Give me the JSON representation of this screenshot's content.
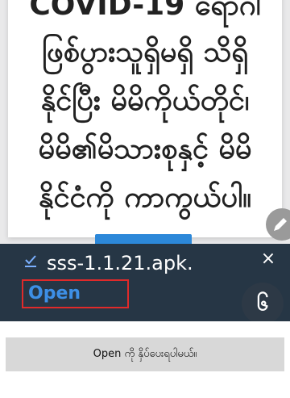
{
  "article": {
    "lines": [
      "COVID-19 ရောဂါ",
      "ဖြစ်ပွားသူရှိမရှိ သိရှိ",
      "နိုင်ပြီး မိမိကိုယ်တိုင်၊",
      "မိမိ၏မိသားစုနှင့် မိမိ",
      "နိုင်ငံကို ကာကွယ်ပါ။"
    ]
  },
  "download": {
    "icon": "download-done-icon",
    "filename": "sss-1.1.21.apk.",
    "close_label": "×",
    "open_label": "Open"
  },
  "edit_icon": "pencil-icon",
  "step_badge": "၆",
  "caption": "Open ကို နှိပ်ပေးရပါမယ်။",
  "colors": {
    "download_bar": "#263645",
    "open_text": "#3d8fe6",
    "highlight_box": "#e02a2a",
    "sheet_tab": "#2c88d9",
    "caption_bg": "#d8d8d8"
  }
}
